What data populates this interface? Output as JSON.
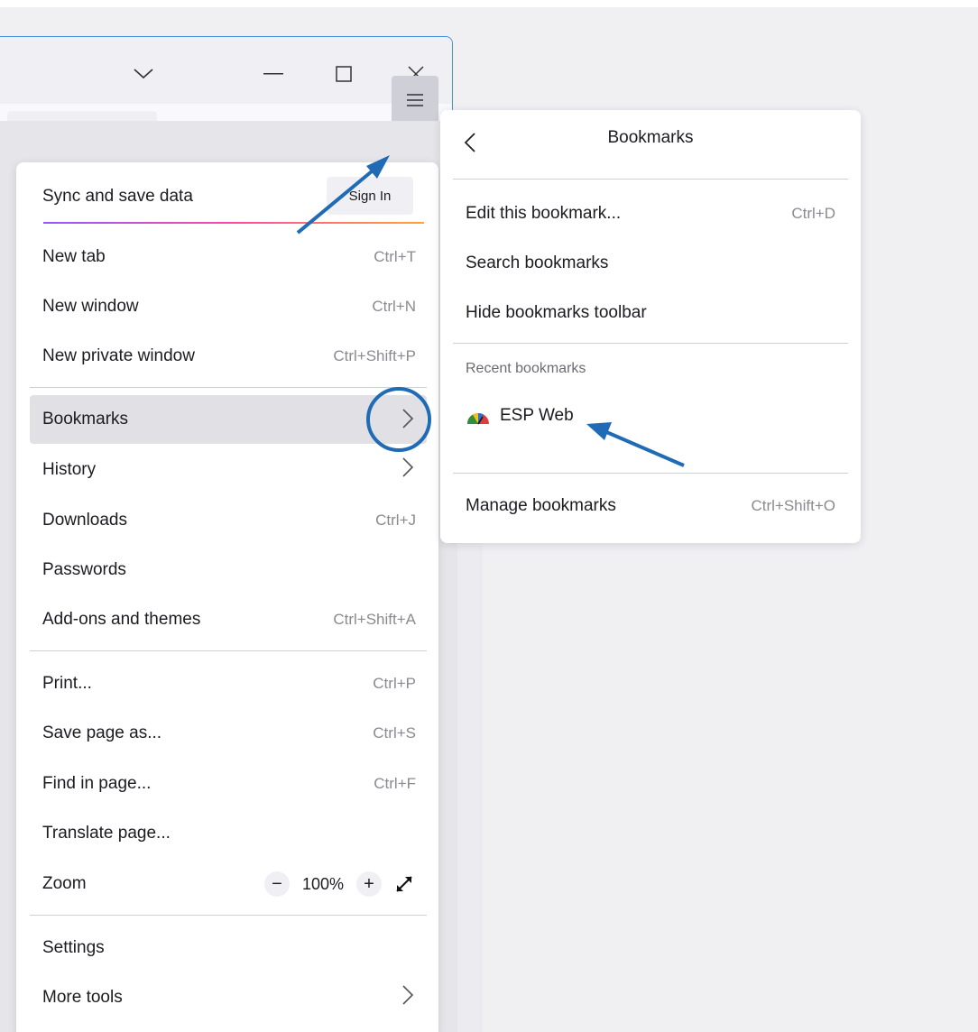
{
  "main_menu": {
    "sync_label": "Sync and save data",
    "sign_in": "Sign In",
    "items": [
      {
        "label": "New tab",
        "shortcut": "Ctrl+T"
      },
      {
        "label": "New window",
        "shortcut": "Ctrl+N"
      },
      {
        "label": "New private window",
        "shortcut": "Ctrl+Shift+P"
      },
      {
        "label": "Bookmarks"
      },
      {
        "label": "History"
      },
      {
        "label": "Downloads",
        "shortcut": "Ctrl+J"
      },
      {
        "label": "Passwords"
      },
      {
        "label": "Add-ons and themes",
        "shortcut": "Ctrl+Shift+A"
      },
      {
        "label": "Print...",
        "shortcut": "Ctrl+P"
      },
      {
        "label": "Save page as...",
        "shortcut": "Ctrl+S"
      },
      {
        "label": "Find in page...",
        "shortcut": "Ctrl+F"
      },
      {
        "label": "Translate page..."
      },
      {
        "label": "Zoom",
        "zoom_value": "100%"
      },
      {
        "label": "Settings"
      },
      {
        "label": "More tools"
      }
    ]
  },
  "bookmarks_panel": {
    "title": "Bookmarks",
    "items": [
      {
        "label": "Edit this bookmark...",
        "shortcut": "Ctrl+D"
      },
      {
        "label": "Search bookmarks"
      },
      {
        "label": "Hide bookmarks toolbar"
      }
    ],
    "recent_heading": "Recent bookmarks",
    "recent": [
      {
        "label": "ESP Web"
      }
    ],
    "manage": {
      "label": "Manage bookmarks",
      "shortcut": "Ctrl+Shift+O"
    }
  },
  "colors": {
    "accent": "#1f6bb5",
    "star": "#0060df",
    "highlight": "#e1e1e5"
  }
}
